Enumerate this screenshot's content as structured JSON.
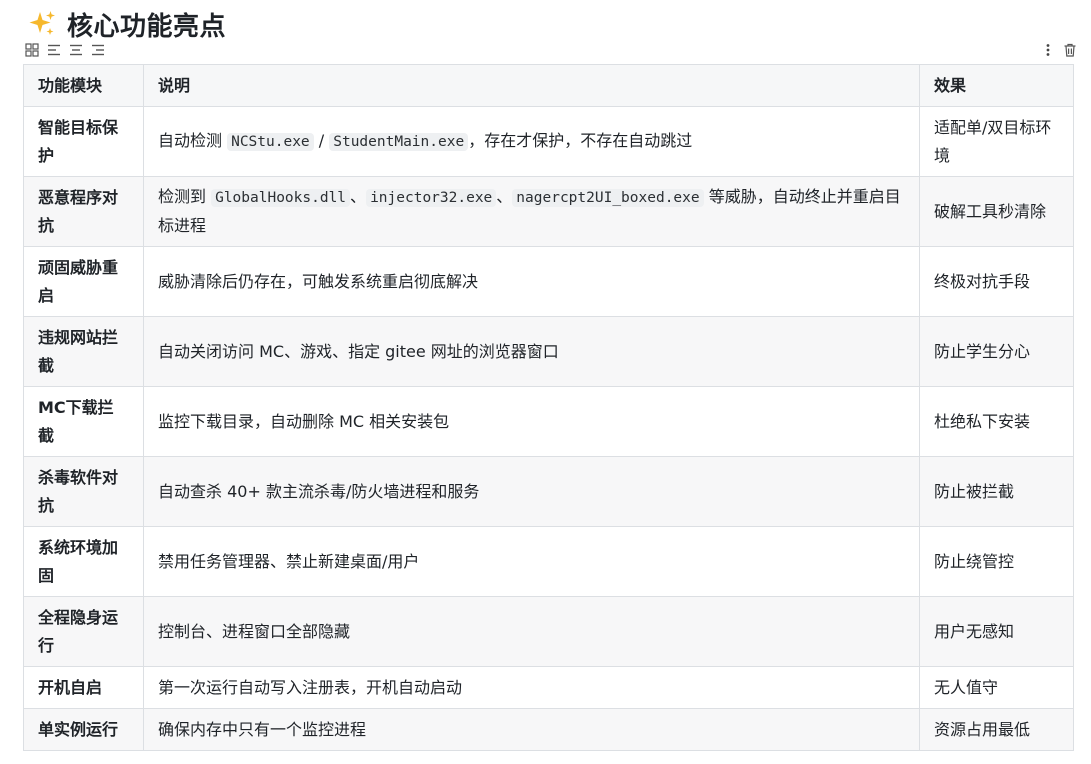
{
  "heading": {
    "emoji": "✨",
    "title": "核心功能亮点"
  },
  "toolbar": {
    "left_icons": [
      "grid-icon",
      "align-left-icon",
      "align-center-icon",
      "align-right-icon"
    ],
    "right_icons": [
      "more-vertical-icon",
      "trash-icon"
    ]
  },
  "table": {
    "headers": [
      "功能模块",
      "说明",
      "效果"
    ],
    "rows": [
      {
        "module": "智能目标保护",
        "desc": [
          {
            "t": "自动检测 "
          },
          {
            "c": "NCStu.exe"
          },
          {
            "t": " / "
          },
          {
            "c": "StudentMain.exe"
          },
          {
            "t": "，存在才保护，不存在自动跳过"
          }
        ],
        "effect": "适配单/双目标环境"
      },
      {
        "module": "恶意程序对抗",
        "desc": [
          {
            "t": "检测到 "
          },
          {
            "c": "GlobalHooks.dll"
          },
          {
            "t": "、"
          },
          {
            "c": "injector32.exe"
          },
          {
            "t": "、"
          },
          {
            "c": "nagercpt2UI_boxed.exe"
          },
          {
            "t": " 等威胁，自动终止并重启目标进程"
          }
        ],
        "effect": "破解工具秒清除"
      },
      {
        "module": "顽固威胁重启",
        "desc": [
          {
            "t": "威胁清除后仍存在，可触发系统重启彻底解决"
          }
        ],
        "effect": "终极对抗手段"
      },
      {
        "module": "违规网站拦截",
        "desc": [
          {
            "t": "自动关闭访问 MC、游戏、指定 gitee 网址的浏览器窗口"
          }
        ],
        "effect": "防止学生分心"
      },
      {
        "module": "MC下载拦截",
        "desc": [
          {
            "t": "监控下载目录，自动删除 MC 相关安装包"
          }
        ],
        "effect": "杜绝私下安装"
      },
      {
        "module": "杀毒软件对抗",
        "desc": [
          {
            "t": "自动查杀 40+ 款主流杀毒/防火墙进程和服务"
          }
        ],
        "effect": "防止被拦截"
      },
      {
        "module": "系统环境加固",
        "desc": [
          {
            "t": "禁用任务管理器、禁止新建桌面/用户"
          }
        ],
        "effect": "防止绕管控"
      },
      {
        "module": "全程隐身运行",
        "desc": [
          {
            "t": "控制台、进程窗口全部隐藏"
          }
        ],
        "effect": "用户无感知"
      },
      {
        "module": "开机自启",
        "desc": [
          {
            "t": "第一次运行自动写入注册表，开机自动启动"
          }
        ],
        "effect": "无人值守"
      },
      {
        "module": "单实例运行",
        "desc": [
          {
            "t": "确保内存中只有一个监控进程"
          }
        ],
        "effect": "资源占用最低"
      }
    ]
  }
}
